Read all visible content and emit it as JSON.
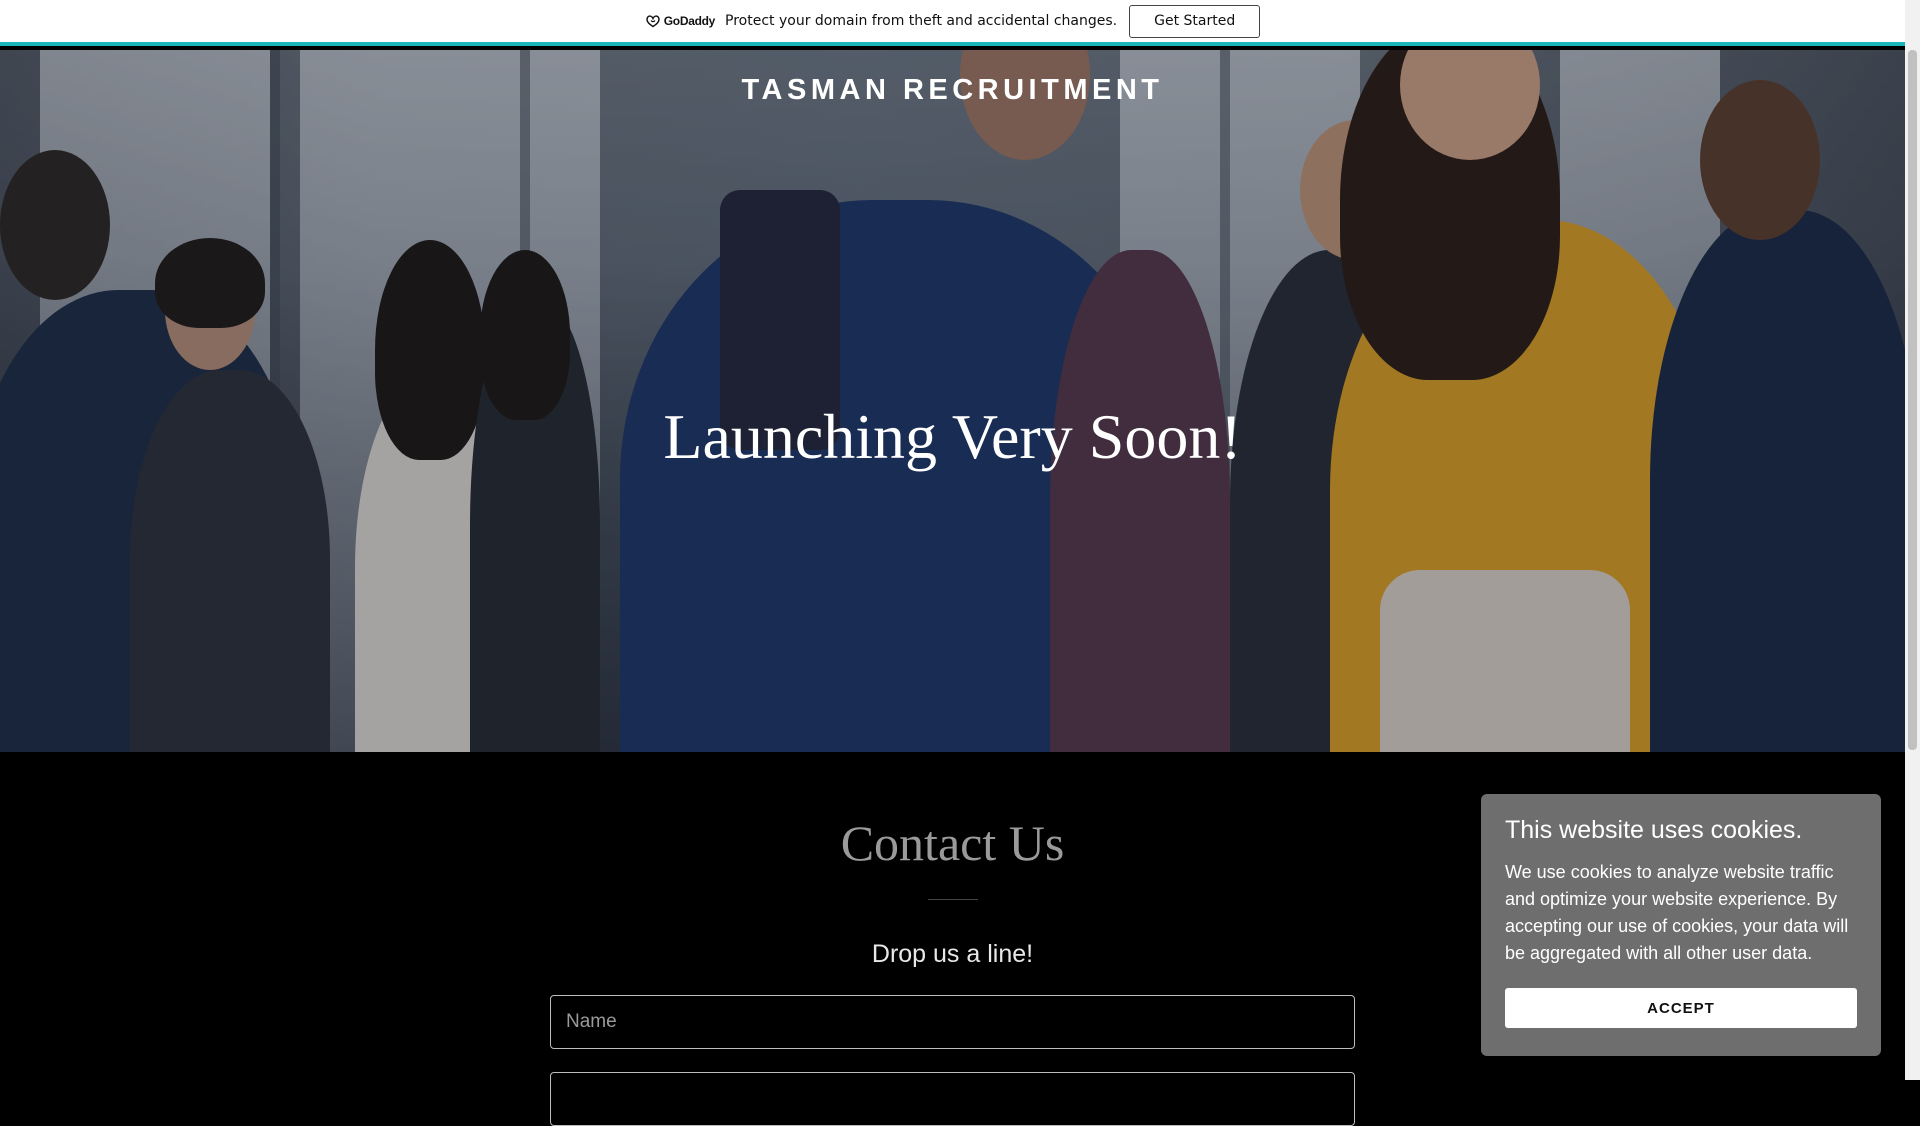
{
  "promo_bar": {
    "logo_text": "GoDaddy",
    "message": "Protect your domain from theft and accidental changes.",
    "cta_label": "Get Started"
  },
  "hero": {
    "site_title": "TASMAN RECRUITMENT",
    "heading": "Launching Very Soon!"
  },
  "contact": {
    "title": "Contact Us",
    "subtitle": "Drop us a line!",
    "name_placeholder": "Name",
    "email_placeholder": ""
  },
  "cookie_banner": {
    "title": "This website uses cookies.",
    "body": "We use cookies to analyze website traffic and optimize your website experience. By accepting our use of cookies, your data will be aggregated with all other user data.",
    "accept_label": "ACCEPT"
  },
  "colors": {
    "accent_teal": "#1bb6b9",
    "cookie_bg": "#6e6e6e",
    "contact_bg": "#000000"
  }
}
